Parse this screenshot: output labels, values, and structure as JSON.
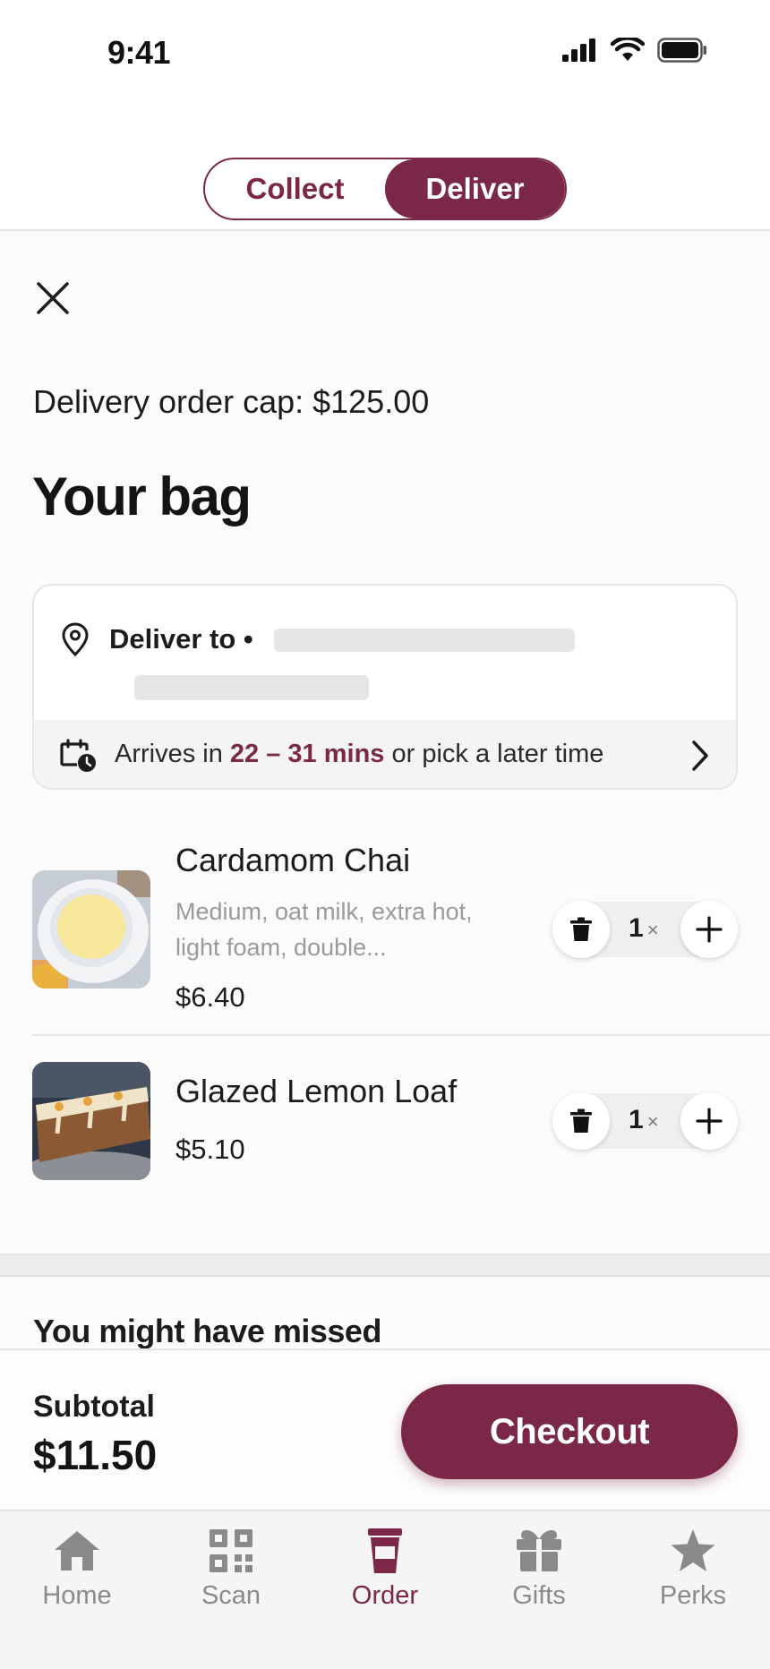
{
  "status_bar": {
    "time": "9:41"
  },
  "mode_toggle": {
    "collect_label": "Collect",
    "deliver_label": "Deliver",
    "selected": "Deliver"
  },
  "cap": {
    "text": "Delivery order cap: $125.00"
  },
  "bag": {
    "title": "Your bag"
  },
  "delivery": {
    "deliver_to_label": "Deliver to •",
    "arrives_prefix": "Arrives in ",
    "arrives_range": "22 – 31 mins",
    "arrives_suffix": " or pick a later time"
  },
  "items": [
    {
      "name": "Cardamom Chai",
      "description": "Medium, oat milk, extra hot, light foam, double...",
      "price": "$6.40",
      "quantity": "1"
    },
    {
      "name": "Glazed Lemon Loaf",
      "description": "",
      "price": "$5.10",
      "quantity": "1"
    }
  ],
  "qty_suffix": "×",
  "missed": {
    "title": "You might have missed"
  },
  "checkout": {
    "subtotal_label": "Subtotal",
    "subtotal_value": "$11.50",
    "button_label": "Checkout"
  },
  "tabs": [
    {
      "label": "Home",
      "icon": "home-icon"
    },
    {
      "label": "Scan",
      "icon": "qr-code-icon"
    },
    {
      "label": "Order",
      "icon": "cup-icon",
      "active": true
    },
    {
      "label": "Gifts",
      "icon": "gift-icon"
    },
    {
      "label": "Perks",
      "icon": "star-icon"
    }
  ],
  "colors": {
    "accent": "#7b2747",
    "tab_inactive": "#8a8a8a"
  }
}
